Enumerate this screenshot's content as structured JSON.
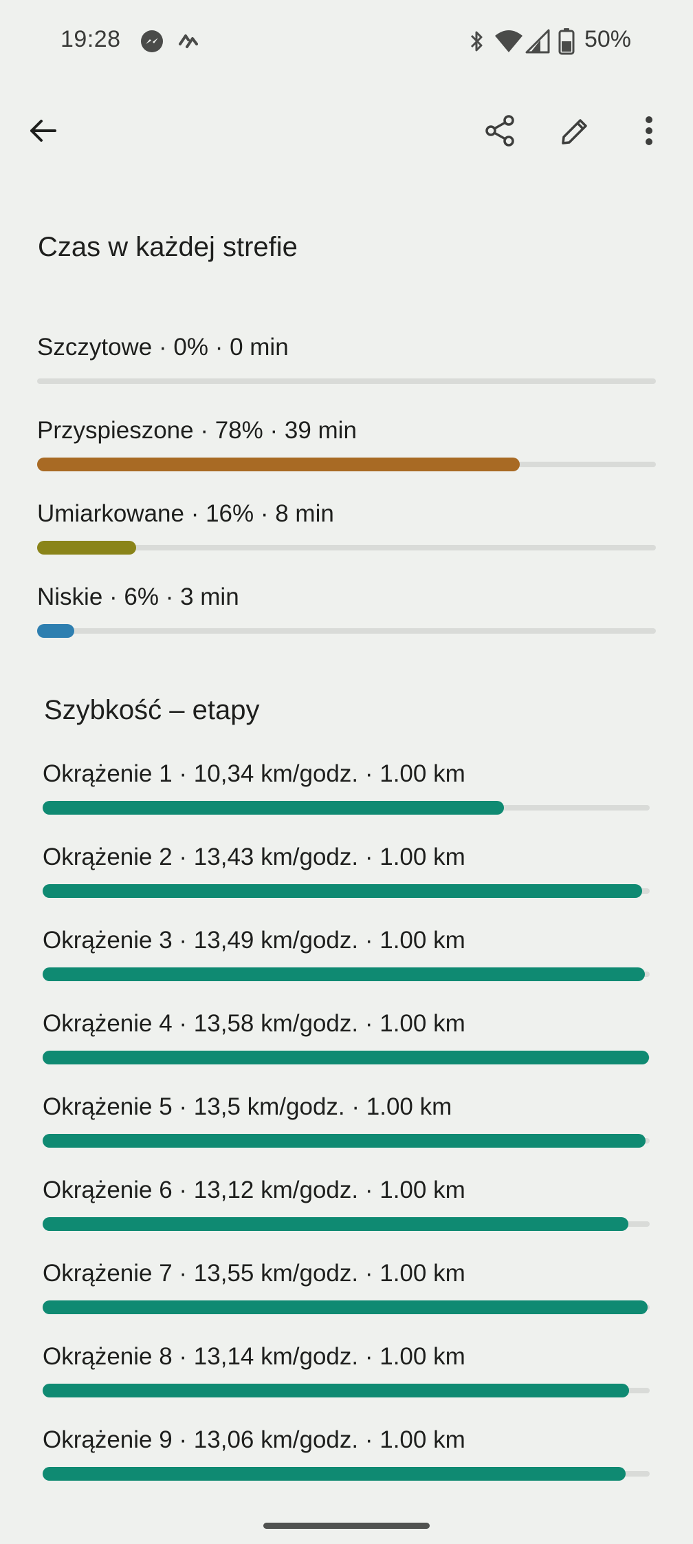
{
  "status_bar": {
    "time": "19:28",
    "battery": "50%",
    "left_icons": [
      "messenger-icon",
      "strava-icon"
    ],
    "right_icons": [
      "bluetooth-icon",
      "wifi-icon",
      "signal-icon",
      "battery-icon"
    ]
  },
  "app_bar": {
    "back_icon": "arrow-left-icon",
    "actions": [
      "share-icon",
      "edit-icon",
      "more-vert-icon"
    ]
  },
  "zones": {
    "title": "Czas w każdej strefie",
    "items": [
      {
        "label": "Szczytowe · 0% · 0 min",
        "fraction": 0.0,
        "color": "#a86a24"
      },
      {
        "label": "Przyspieszone · 78% · 39 min",
        "fraction": 0.78,
        "color": "#a86a24"
      },
      {
        "label": "Umiarkowane · 16% · 8 min",
        "fraction": 0.16,
        "color": "#8a8419"
      },
      {
        "label": "Niskie · 6% · 3 min",
        "fraction": 0.06,
        "color": "#2e7fb0"
      }
    ]
  },
  "laps": {
    "title": "Szybkość – etapy",
    "max_speed_kmh": 13.6,
    "color": "#0f8a72",
    "items": [
      {
        "label": "Okrążenie 1 · 10,34 km/godz. · 1.00 km",
        "speed": 10.34
      },
      {
        "label": "Okrążenie 2 · 13,43 km/godz. · 1.00 km",
        "speed": 13.43
      },
      {
        "label": "Okrążenie 3 · 13,49 km/godz. · 1.00 km",
        "speed": 13.49
      },
      {
        "label": "Okrążenie 4 · 13,58 km/godz. · 1.00 km",
        "speed": 13.58
      },
      {
        "label": "Okrążenie 5 · 13,5 km/godz. · 1.00 km",
        "speed": 13.5
      },
      {
        "label": "Okrążenie 6 · 13,12 km/godz. · 1.00 km",
        "speed": 13.12
      },
      {
        "label": "Okrążenie 7 · 13,55 km/godz. · 1.00 km",
        "speed": 13.55
      },
      {
        "label": "Okrążenie 8 · 13,14 km/godz. · 1.00 km",
        "speed": 13.14
      },
      {
        "label": "Okrążenie 9 · 13,06 km/godz. · 1.00 km",
        "speed": 13.06
      }
    ]
  }
}
